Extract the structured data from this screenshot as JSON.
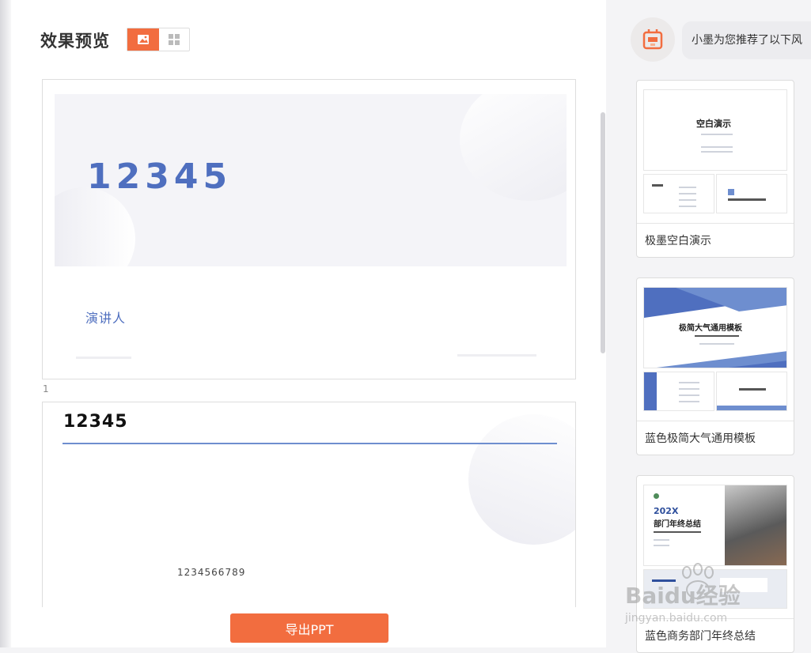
{
  "preview": {
    "title": "效果预览",
    "view_modes": [
      "single-image-icon",
      "grid-icon"
    ],
    "export_label": "导出PPT"
  },
  "slides": [
    {
      "page": "1",
      "title": "12345",
      "speaker": "演讲人"
    },
    {
      "title": "12345",
      "body": "1234566789"
    }
  ],
  "assistant": {
    "message": "小墨为您推荐了以下风"
  },
  "templates": [
    {
      "name": "极墨空白演示",
      "cover_title": "空白演示"
    },
    {
      "name": "蓝色极简大气通用模板",
      "cover_title": "极简大气通用模板"
    },
    {
      "name": "蓝色商务部门年终总结",
      "cover_title": "部门年终总结",
      "cover_year": "202X"
    }
  ],
  "watermark": {
    "brand": "Baidu经验",
    "url": "jingyan.baidu.com"
  },
  "colors": {
    "accent": "#f26d3f",
    "slide_blue": "#4f6fbf"
  }
}
